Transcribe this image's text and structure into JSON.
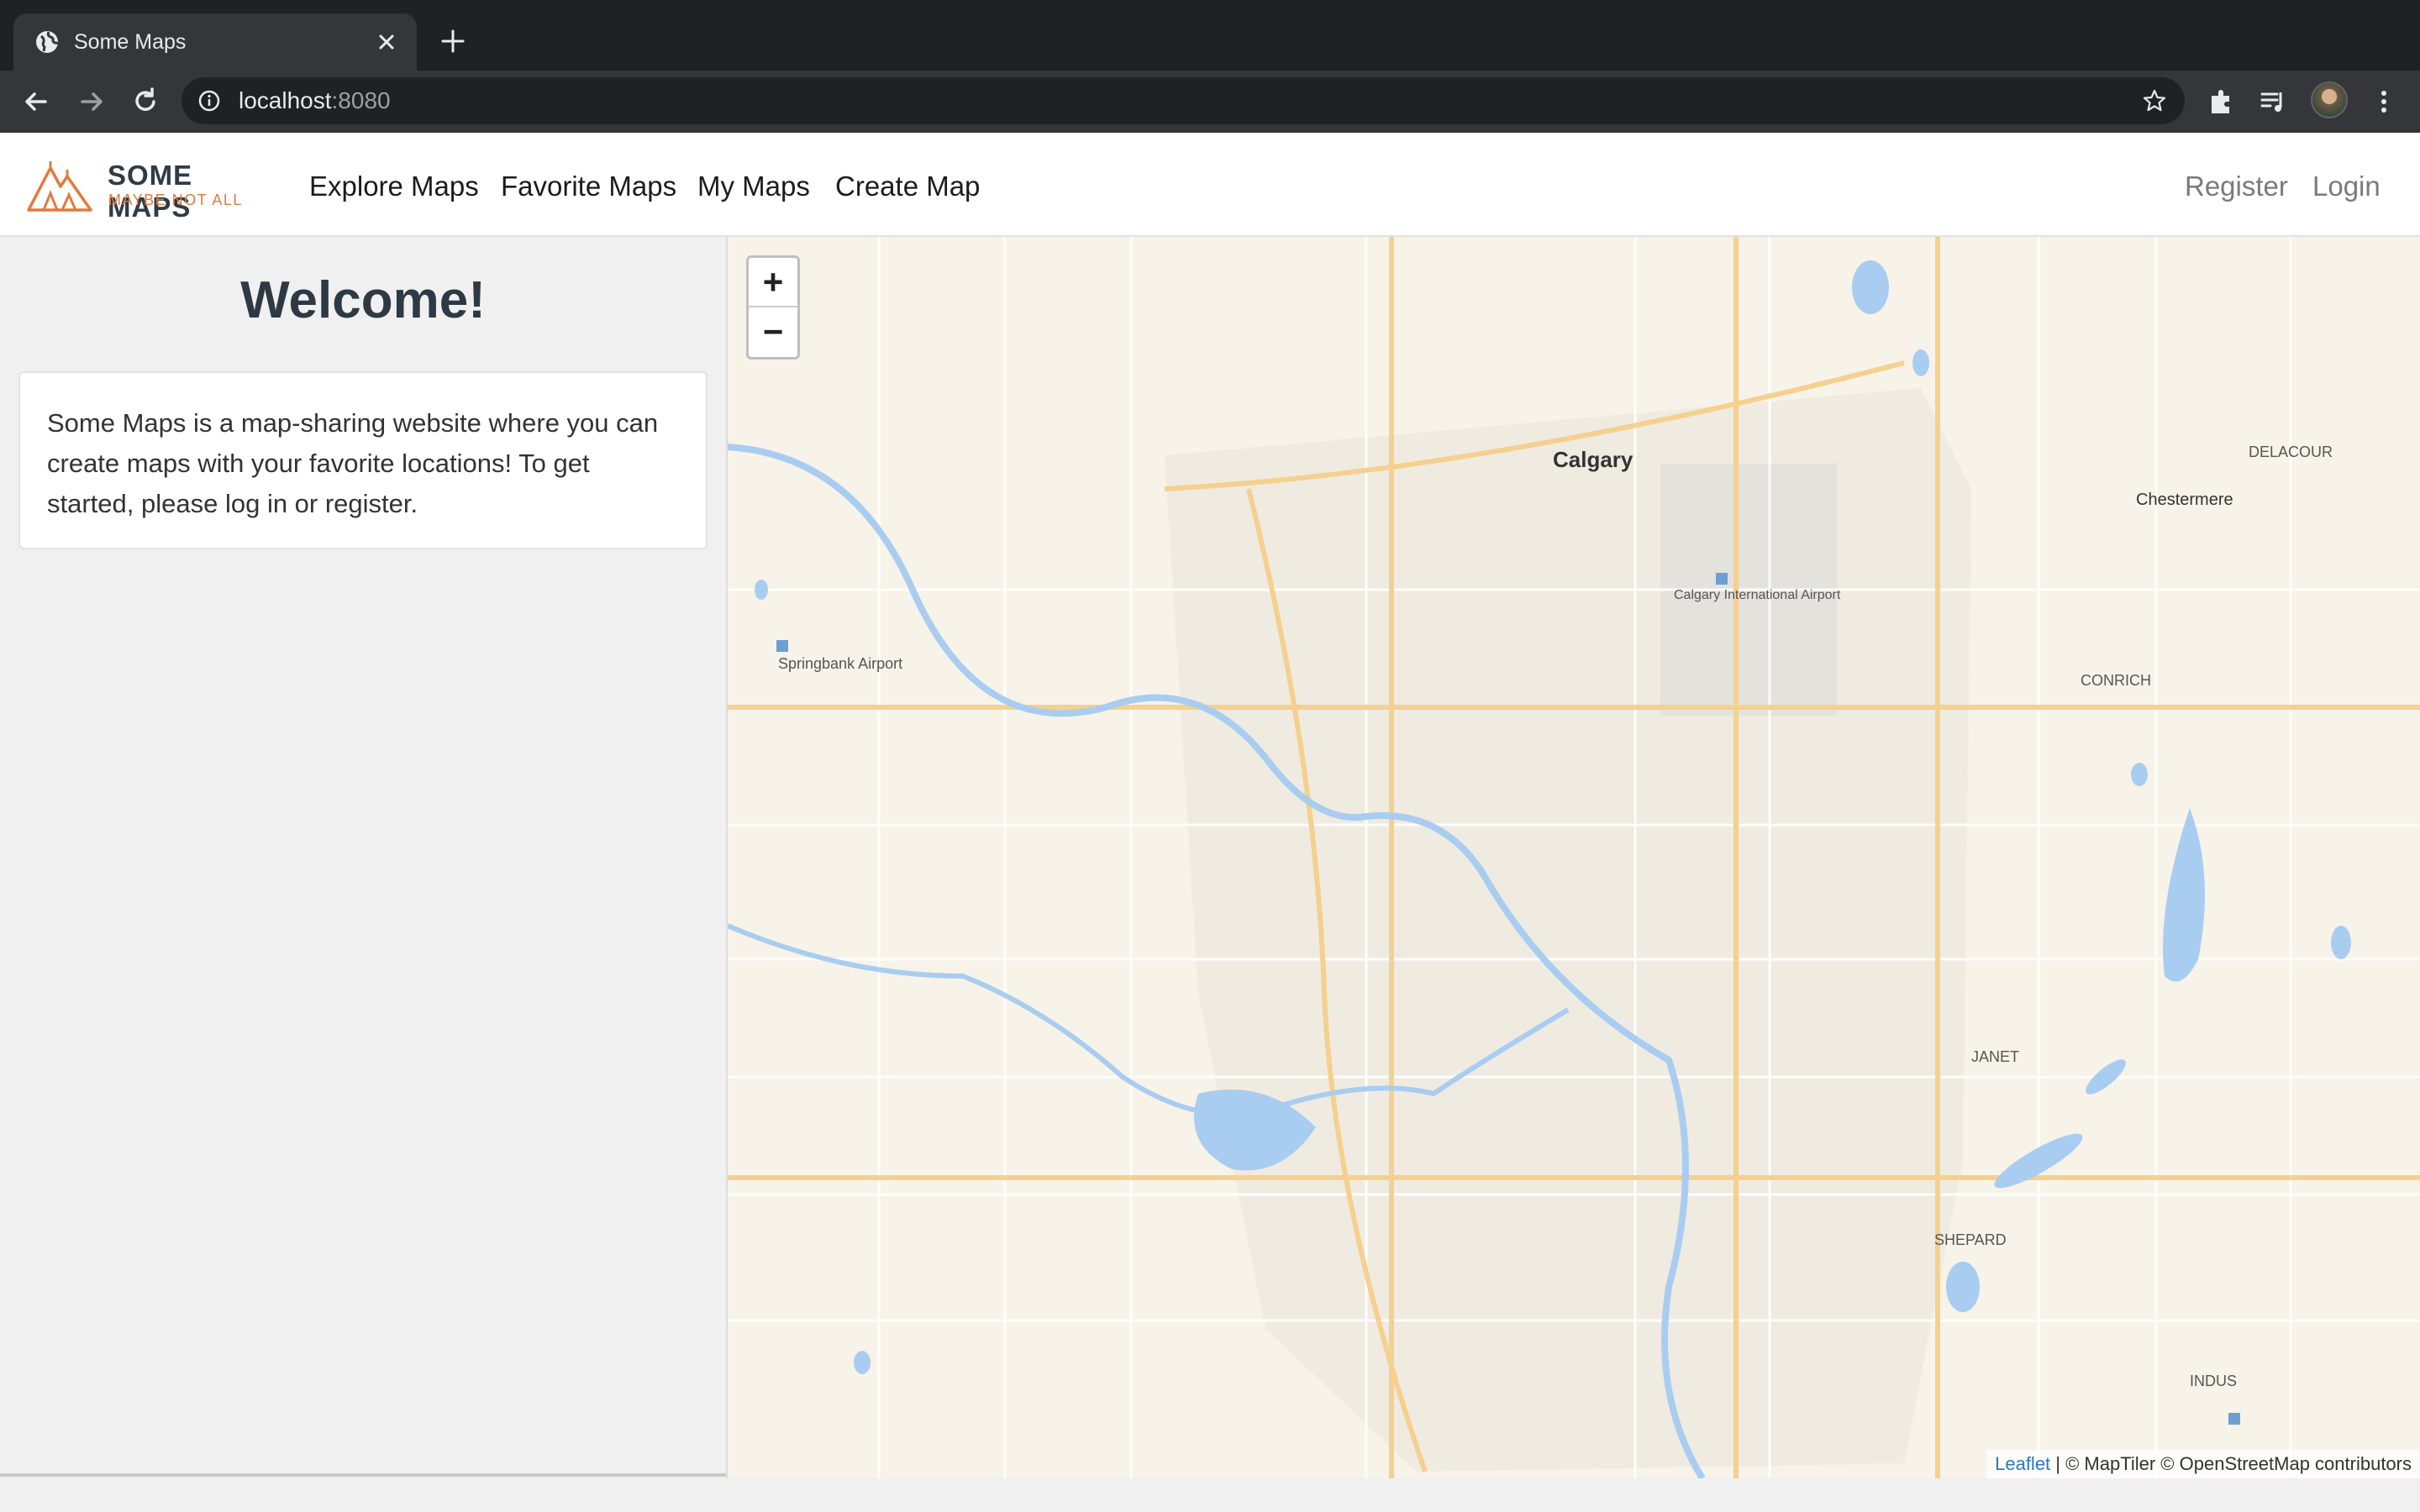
{
  "browser": {
    "tab_title": "Some Maps",
    "url_host": "localhost",
    "url_port": ":8080"
  },
  "navbar": {
    "brand_name": "SOME MAPS",
    "brand_tagline": "MAYBE NOT ALL",
    "links": [
      "Explore Maps",
      "Favorite Maps",
      "My Maps",
      "Create Map"
    ],
    "register": "Register",
    "login": "Login"
  },
  "sidebar": {
    "heading": "Welcome!",
    "intro": "Some Maps is a map-sharing website where you can create maps with your favorite locations! To get started, please log in or register."
  },
  "map": {
    "zoom_in": "+",
    "zoom_out": "−",
    "city": "Calgary",
    "town": "Chestermere",
    "attribution_leaflet": "Leaflet",
    "attribution_rest": " | © MapTiler © OpenStreetMap contributors",
    "labels": {
      "airport": "Springbank Airport",
      "intl_airport": "Calgary International Airport",
      "delacour": "DELACOUR",
      "conrich": "CONRICH",
      "janet": "JANET",
      "indus": "INDUS",
      "shepard": "SHEPARD"
    }
  }
}
